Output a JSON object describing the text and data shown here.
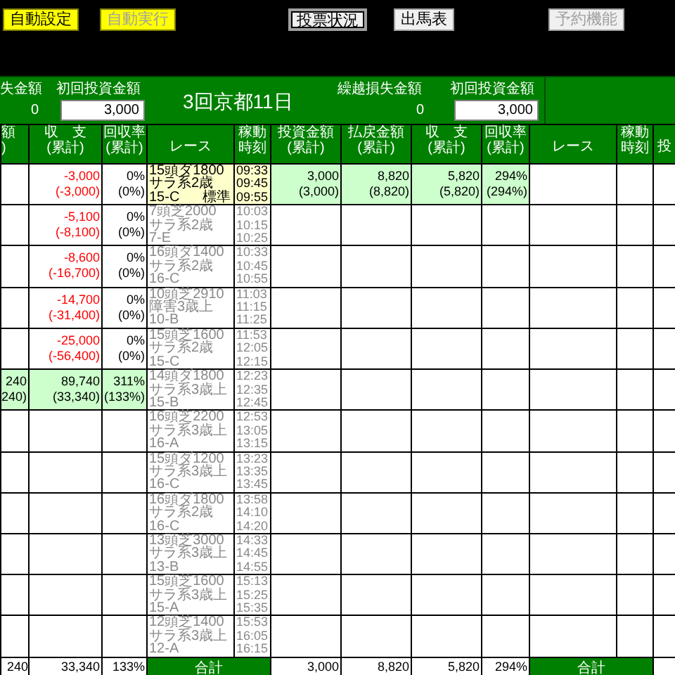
{
  "toolbar": {
    "buttons": [
      {
        "label": "自動設定",
        "kind": "yellow",
        "disabled": false,
        "focused": false
      },
      {
        "label": "自動実行",
        "kind": "yellow",
        "disabled": true,
        "focused": false
      },
      {
        "label": "投票状況",
        "kind": "plain",
        "disabled": false,
        "focused": true
      },
      {
        "label": "出馬表",
        "kind": "plain",
        "disabled": false,
        "focused": false
      },
      {
        "label": "予約機能",
        "kind": "plain",
        "disabled": true,
        "focused": false
      }
    ]
  },
  "summary": {
    "left_loss_label": "失金額",
    "left_loss_value": "0",
    "left_initial_label": "初回投資金額",
    "left_initial_value": "3,000",
    "meeting": "3回京都11日",
    "right_loss_label": "繰越損失金額",
    "right_loss_value": "0",
    "right_initial_label": "初回投資金額",
    "right_initial_value": "3,000"
  },
  "columns": [
    {
      "lines": [
        "額",
        ")"
      ]
    },
    {
      "lines": [
        "収　支",
        "(累計)"
      ]
    },
    {
      "lines": [
        "回収率",
        "(累計)"
      ]
    },
    {
      "lines": [
        "レース"
      ]
    },
    {
      "lines": [
        "稼動",
        "時刻"
      ]
    },
    {
      "lines": [
        "投資金額",
        "(累計)"
      ]
    },
    {
      "lines": [
        "払戻金額",
        "(累計)"
      ]
    },
    {
      "lines": [
        "収　支",
        "(累計)"
      ]
    },
    {
      "lines": [
        "回収率",
        "(累計)"
      ]
    },
    {
      "lines": [
        "レース"
      ]
    },
    {
      "lines": [
        "稼動",
        "時刻"
      ]
    },
    {
      "lines": [
        "投"
      ]
    }
  ],
  "rows": [
    {
      "balance": [
        "-3,000",
        "(-3,000)"
      ],
      "balance_negative": true,
      "rate": [
        "0%",
        "(0%)"
      ],
      "left_highlight": false,
      "race": [
        "15頭ダ1800",
        "サラ系2歳",
        "15-C"
      ],
      "grade": "標準",
      "times": [
        "09:33",
        "09:45",
        "09:55"
      ],
      "current": true,
      "investment": [
        "3,000",
        "(3,000)"
      ],
      "payout": [
        "8,820",
        "(8,820)"
      ],
      "right_balance": [
        "5,820",
        "(5,820)"
      ],
      "right_rate": [
        "294%",
        "(294%)"
      ],
      "right_highlight": true
    },
    {
      "balance": [
        "-5,100",
        "(-8,100)"
      ],
      "balance_negative": true,
      "rate": [
        "0%",
        "(0%)"
      ],
      "left_highlight": false,
      "race": [
        "7頭芝2000",
        "サラ系2歳",
        "7-E"
      ],
      "times": [
        "10:03",
        "10:15",
        "10:25"
      ],
      "current": false,
      "right_highlight": false
    },
    {
      "balance": [
        "-8,600",
        "(-16,700)"
      ],
      "balance_negative": true,
      "rate": [
        "0%",
        "(0%)"
      ],
      "left_highlight": false,
      "race": [
        "16頭ダ1400",
        "サラ系2歳",
        "16-C"
      ],
      "times": [
        "10:33",
        "10:45",
        "10:55"
      ],
      "current": false,
      "right_highlight": false
    },
    {
      "balance": [
        "-14,700",
        "(-31,400)"
      ],
      "balance_negative": true,
      "rate": [
        "0%",
        "(0%)"
      ],
      "left_highlight": false,
      "race": [
        "10頭芝2910",
        "障害3歳上",
        "10-B"
      ],
      "times": [
        "11:03",
        "11:15",
        "11:25"
      ],
      "current": false,
      "right_highlight": false
    },
    {
      "balance": [
        "-25,000",
        "(-56,400)"
      ],
      "balance_negative": true,
      "rate": [
        "0%",
        "(0%)"
      ],
      "left_highlight": false,
      "race": [
        "15頭芝1600",
        "サラ系2歳",
        "15-C"
      ],
      "times": [
        "11:53",
        "12:05",
        "12:15"
      ],
      "current": false,
      "right_highlight": false
    },
    {
      "column_1": [
        "240",
        "240)"
      ],
      "balance": [
        "89,740",
        "(33,340)"
      ],
      "balance_negative": false,
      "rate": [
        "311%",
        "(133%)"
      ],
      "left_highlight": true,
      "race": [
        "14頭ダ1800",
        "サラ系3歳上",
        "15-B"
      ],
      "times": [
        "12:23",
        "12:35",
        "12:45"
      ],
      "current": false,
      "right_highlight": false
    },
    {
      "left_highlight": false,
      "race": [
        "16頭芝2200",
        "サラ系3歳上",
        "16-A"
      ],
      "times": [
        "12:53",
        "13:05",
        "13:15"
      ],
      "current": false,
      "right_highlight": false
    },
    {
      "left_highlight": false,
      "race": [
        "15頭ダ1200",
        "サラ系3歳上",
        "16-C"
      ],
      "times": [
        "13:23",
        "13:35",
        "13:45"
      ],
      "current": false,
      "right_highlight": false
    },
    {
      "left_highlight": false,
      "race": [
        "16頭ダ1800",
        "サラ系2歳",
        "16-C"
      ],
      "times": [
        "13:58",
        "14:10",
        "14:20"
      ],
      "current": false,
      "right_highlight": false
    },
    {
      "left_highlight": false,
      "race": [
        "13頭芝3000",
        "サラ系3歳上",
        "13-B"
      ],
      "times": [
        "14:33",
        "14:45",
        "14:55"
      ],
      "current": false,
      "right_highlight": false
    },
    {
      "left_highlight": false,
      "race": [
        "15頭芝1600",
        "サラ系3歳上",
        "15-A"
      ],
      "times": [
        "15:13",
        "15:25",
        "15:35"
      ],
      "current": false,
      "right_highlight": false
    },
    {
      "left_highlight": false,
      "race": [
        "12頭芝1400",
        "サラ系3歳上",
        "12-A"
      ],
      "times": [
        "15:53",
        "16:05",
        "16:15"
      ],
      "current": false,
      "right_highlight": false
    }
  ],
  "totals": {
    "column_1": "240",
    "balance": "33,340",
    "rate": "133%",
    "label": "合計",
    "investment": "3,000",
    "payout": "8,820",
    "right_balance": "5,820",
    "right_rate": "294%",
    "right_label": "合計"
  }
}
